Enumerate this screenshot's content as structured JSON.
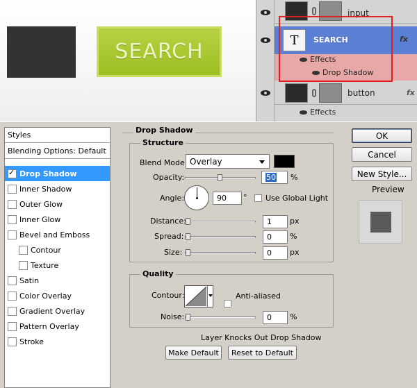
{
  "canvas": {
    "button_text": "SEARCH"
  },
  "layers": {
    "items": [
      {
        "name": "input",
        "fx": ""
      },
      {
        "name": "SEARCH",
        "thumb_letter": "T",
        "fx": "fx",
        "effects_label": "Effects",
        "effect": "Drop Shadow"
      },
      {
        "name": "button",
        "fx": "fx",
        "effects_label": "Effects"
      }
    ]
  },
  "dialog": {
    "styles_header": "Styles",
    "blending_options": "Blending Options: Default",
    "effects": [
      {
        "label": "Drop Shadow",
        "checked": true,
        "selected": true
      },
      {
        "label": "Inner Shadow",
        "checked": false
      },
      {
        "label": "Outer Glow",
        "checked": false
      },
      {
        "label": "Inner Glow",
        "checked": false
      },
      {
        "label": "Bevel and Emboss",
        "checked": false
      },
      {
        "label": "Contour",
        "checked": false
      },
      {
        "label": "Texture",
        "checked": false
      },
      {
        "label": "Satin",
        "checked": false
      },
      {
        "label": "Color Overlay",
        "checked": false
      },
      {
        "label": "Gradient Overlay",
        "checked": false
      },
      {
        "label": "Pattern Overlay",
        "checked": false
      },
      {
        "label": "Stroke",
        "checked": false
      }
    ],
    "panel_title": "Drop Shadow",
    "structure_title": "Structure",
    "blend_mode_label": "Blend Mode:",
    "blend_mode_value": "Overlay",
    "shadow_color": "#000000",
    "opacity_label": "Opacity:",
    "opacity_value": "50",
    "opacity_unit": "%",
    "opacity_level": 0.5,
    "angle_label": "Angle:",
    "angle_value": "90",
    "angle_unit": "°",
    "global_light_label": "Use Global Light",
    "distance_label": "Distance:",
    "distance_value": "1",
    "distance_unit": "px",
    "spread_label": "Spread:",
    "spread_value": "0",
    "spread_unit": "%",
    "size_label": "Size:",
    "size_value": "0",
    "size_unit": "px",
    "quality_title": "Quality",
    "contour_label": "Contour:",
    "anti_aliased_label": "Anti-aliased",
    "noise_label": "Noise:",
    "noise_value": "0",
    "noise_unit": "%",
    "knockout_label": "Layer Knocks Out Drop Shadow",
    "make_default_label": "Make Default",
    "reset_default_label": "Reset to Default",
    "ok_label": "OK",
    "cancel_label": "Cancel",
    "new_style_label": "New Style...",
    "preview_label": "Preview"
  }
}
